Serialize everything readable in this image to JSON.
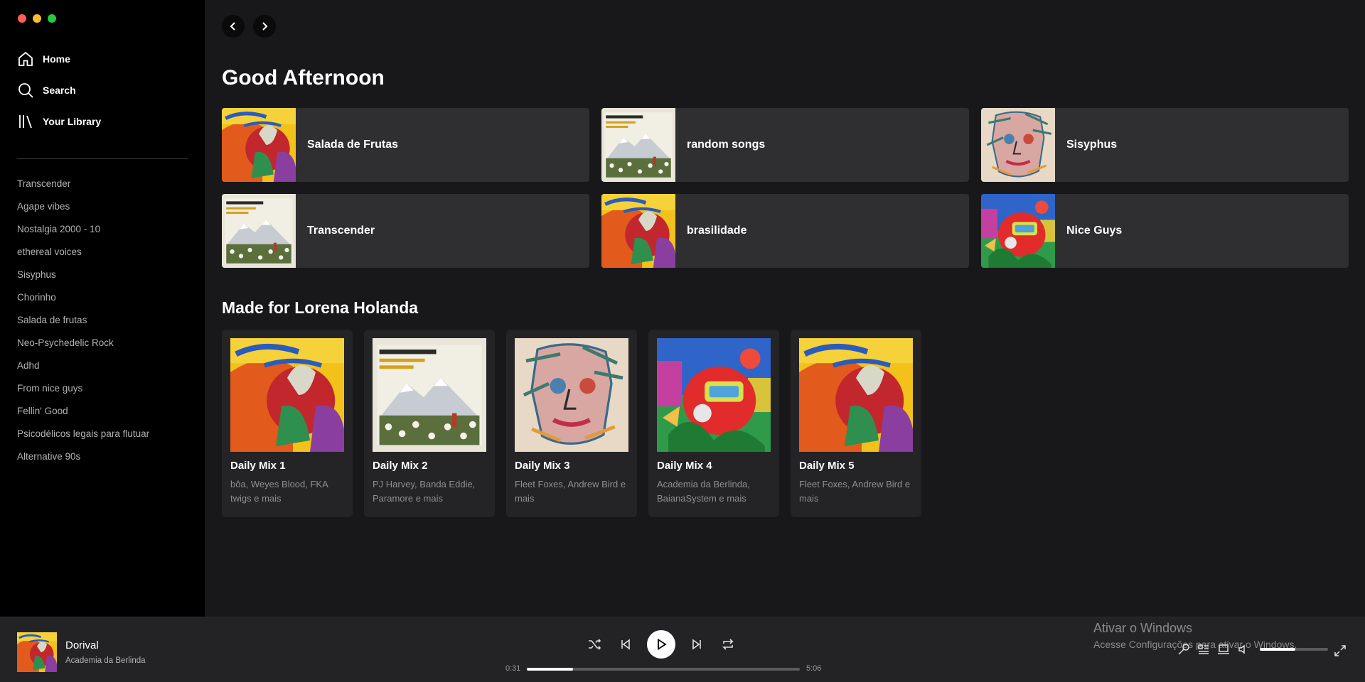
{
  "window": {
    "traffic_lights": [
      "#ff5f57",
      "#febc2e",
      "#28c840"
    ]
  },
  "sidebar": {
    "nav": [
      {
        "label": "Home",
        "icon": "home-icon"
      },
      {
        "label": "Search",
        "icon": "search-icon"
      },
      {
        "label": "Your Library",
        "icon": "library-icon"
      }
    ],
    "playlists": [
      "Transcender",
      "Agape vibes",
      "Nostalgia 2000 - 10",
      "ethereal voices",
      "Sisyphus",
      "Chorinho",
      "Salada de frutas",
      "Neo-Psychedelic Rock",
      "Adhd",
      "From nice guys",
      "Fellin' Good",
      "Psicodélicos legais para flutuar",
      "Alternative 90s"
    ]
  },
  "main": {
    "greeting": "Good Afternoon",
    "quick": [
      {
        "title": "Salada de Frutas",
        "cover": "rooster-art"
      },
      {
        "title": "random songs",
        "cover": "mountain-art"
      },
      {
        "title": "Sisyphus",
        "cover": "face-art"
      },
      {
        "title": "Transcender",
        "cover": "mountain-art"
      },
      {
        "title": "brasilidade",
        "cover": "rooster-art"
      },
      {
        "title": "Nice Guys",
        "cover": "robot-art"
      }
    ],
    "made_for_heading": "Made for Lorena Holanda",
    "mixes": [
      {
        "title": "Daily Mix 1",
        "subtitle": "bôa, Weyes Blood, FKA twigs e mais",
        "cover": "rooster-art"
      },
      {
        "title": "Daily Mix 2",
        "subtitle": "PJ Harvey, Banda Eddie, Paramore e mais",
        "cover": "mountain-art"
      },
      {
        "title": "Daily Mix 3",
        "subtitle": "Fleet Foxes, Andrew Bird e mais",
        "cover": "face-art"
      },
      {
        "title": "Daily Mix 4",
        "subtitle": "Academia da Berlinda, BaianaSystem e mais",
        "cover": "robot-art"
      },
      {
        "title": "Daily Mix 5",
        "subtitle": "Fleet Foxes, Andrew Bird e mais",
        "cover": "rooster-art"
      }
    ]
  },
  "player": {
    "track": "Dorival",
    "artist": "Academia da Berlinda",
    "elapsed": "0:31",
    "duration": "5:06",
    "progress": 0.17,
    "volume": 0.52,
    "controls": [
      "shuffle-icon",
      "previous-icon",
      "play-icon",
      "next-icon",
      "repeat-icon"
    ],
    "right_icons": [
      "mic-icon",
      "queue-icon",
      "devices-icon",
      "volume-icon",
      "fullscreen-icon"
    ]
  },
  "watermark": {
    "title": "Ativar o Windows",
    "subtitle": "Acesse Configurações para ativar o Windows."
  },
  "colors": {
    "sidebar_bg": "#000000",
    "main_bg": "#18181a",
    "card_bg": "#2f2f31",
    "mix_bg": "#242426",
    "player_bg": "#232325"
  }
}
